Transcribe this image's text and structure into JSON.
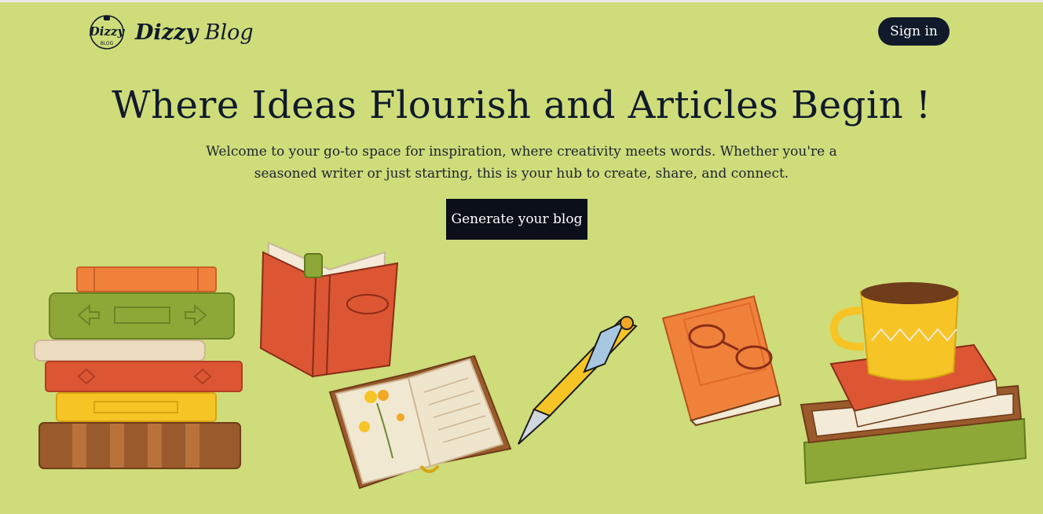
{
  "header": {
    "logo_badge_text": "Dizzy",
    "logo_badge_sub": "BLOG",
    "brand_name": "Dizzy",
    "brand_suffix": "Blog",
    "signin_label": "Sign in"
  },
  "hero": {
    "title": "Where Ideas Flourish and Articles Begin !",
    "subtitle": "Welcome to your go-to space for inspiration, where creativity meets words. Whether you're a seasoned writer or just starting, this is your hub to create, share, and connect.",
    "cta_label": "Generate your blog"
  },
  "colors": {
    "background": "#cedc7a",
    "dark": "#111a2a",
    "book_orange": "#f0813b",
    "book_green": "#8ea838",
    "book_red": "#dc5634",
    "book_yellow": "#f6c425",
    "book_brown": "#9a5a2c"
  },
  "illustrations": [
    "book-stack-left-icon",
    "open-red-book-icon",
    "open-journal-icon",
    "pen-icon",
    "book-with-glasses-icon",
    "coffee-mug-on-books-icon"
  ]
}
